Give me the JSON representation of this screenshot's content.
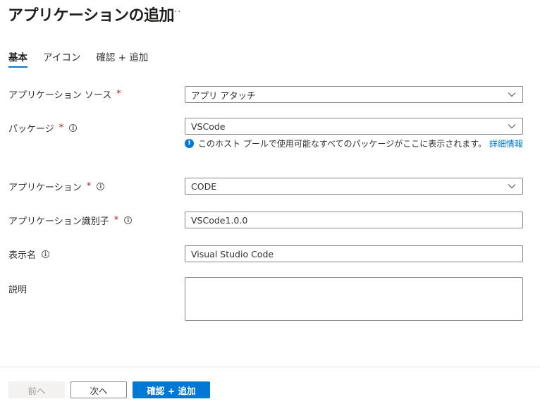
{
  "header": {
    "title": "アプリケーションの追加",
    "more_label": "···"
  },
  "tabs": [
    {
      "label": "基本",
      "active": true
    },
    {
      "label": "アイコン",
      "active": false
    },
    {
      "label": "確認 + 追加",
      "active": false
    }
  ],
  "form": {
    "source": {
      "label": "アプリケーション ソース",
      "required_mark": "*",
      "value": "アプリ アタッチ"
    },
    "package": {
      "label": "パッケージ",
      "required_mark": "*",
      "value": "VSCode",
      "hint": "このホスト プールで使用可能なすべてのパッケージがここに表示されます。",
      "hint_link": "詳細情報"
    },
    "application": {
      "label": "アプリケーション",
      "required_mark": "*",
      "value": "CODE"
    },
    "app_id": {
      "label": "アプリケーション識別子",
      "required_mark": "*",
      "value": "VSCode1.0.0"
    },
    "display_name": {
      "label": "表示名",
      "value": "Visual Studio Code"
    },
    "description": {
      "label": "説明",
      "value": ""
    }
  },
  "footer": {
    "prev_label": "前へ",
    "next_label": "次へ",
    "review_label": "確認 + 追加"
  },
  "colors": {
    "accent": "#0078d4",
    "required": "#a4262c",
    "border": "#8a8886"
  }
}
